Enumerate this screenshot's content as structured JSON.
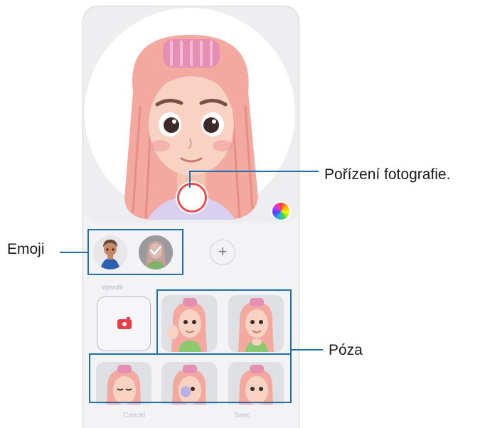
{
  "callouts": {
    "capture": "Pořízení fotografie.",
    "emoji": "Emoji",
    "pose": "Póza"
  },
  "emoji_panel": {
    "add_label": "+",
    "section_label": "Vytvořit"
  },
  "bottom_bar": {
    "cancel_label": "Cancel",
    "save_label": "Save"
  },
  "colors": {
    "accent_highlight": "#1f6fb3",
    "capture_ring": "#ef4b4b",
    "camera_icon": "#ea3c46",
    "hair": "#f3a9a0"
  },
  "icons": {
    "capture": "capture-button-icon",
    "palette": "color-palette-icon",
    "add": "plus-icon",
    "camera": "camera-icon"
  }
}
